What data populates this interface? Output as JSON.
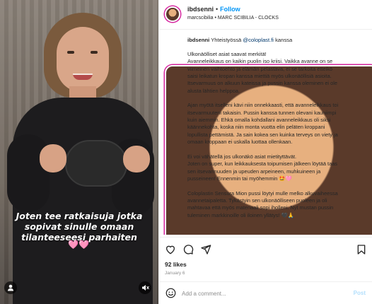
{
  "media": {
    "caption_lines": [
      "Joten tee ratkaisuja jotka",
      "sopivat sinulle omaan",
      "tilanteeseesi parhaiten"
    ],
    "caption_emoji": "🩷🩷",
    "audio_icon": "person-icon",
    "mute_icon": "mute-icon"
  },
  "header": {
    "username": "ibdsenni",
    "dot": "•",
    "follow_label": "Follow",
    "audio_subtitle": "marcscibilia • MARC SCIBILIA - CLOCKS",
    "more_label": "···"
  },
  "post": {
    "author": "ibdsenni",
    "collab_prefix": "Yhteistyössä",
    "collab_mention": "@coloplast.fi",
    "collab_suffix": "kanssa",
    "lines": [
      "Ulkonäölliset asiat saavat merkitä!",
      "Avanneleikkaus on kaikin puolin iso kriisi. Vaikka avanne on se",
      "viimeinen vaihtoehto ja elämän pelastava, ei se tarkoita etteikö",
      "saisi leikatun kropan kanssa miettiä myös ulkonäöllisiä asioita.",
      "Itsevarmuus on alkuun kateissa ja pussin kanssa oleminen ei ole",
      "alusta lähtien helppoa.",
      "",
      "Ajan myötä itselleni kävi niin onnekkaasti, että avanneleikkaus toi",
      "itsevarmuuteni takaisin. Pussin kanssa tunnen olevani kauniimpi",
      "kuin aiemmin. Ehkä omalla kohdallani avanneleikkaus oli siksi",
      "käännekohta, koska niin monta vuotta elin peläten kroppani",
      "lopullista pettämistä. Ja sain kokea sen kuinka terveys on viety ja",
      "omaan kroppaan ei uskalla luottaa ollenkaan.",
      "",
      "Ei voi vähätellä jos ulkonäkö asiat mietityttävät.",
      "Joten on super, kun leikkauksesta toipumisen jälkeen löytää taas",
      "sen itsevarmuuden ja upeuden arpeineen, muhkuineen ja",
      "pusseineen! Ennenmin tai myöhemmin 🤩🩷",
      "",
      "Coloplastin Sensura Mion pussi löytyi mulle melko alkuvaiheessa",
      "avannetaipaletta. Tykästyin sen ulkonäölliseen puoleen ja oli",
      "mahtavaa että myös materiaali sopi iholleni. Nyt mustan pussin",
      "tuleminen markkinoille oli iloinen yllätys! 🖤🙏"
    ]
  },
  "actions": {
    "like_icon": "heart-icon",
    "comment_icon": "comment-icon",
    "share_icon": "share-icon",
    "save_icon": "bookmark-icon"
  },
  "stats": {
    "likes": "92 likes",
    "date": "January 6"
  },
  "comment": {
    "placeholder": "Add a comment...",
    "post_label": "Post",
    "emoji_icon": "smiley-icon"
  }
}
